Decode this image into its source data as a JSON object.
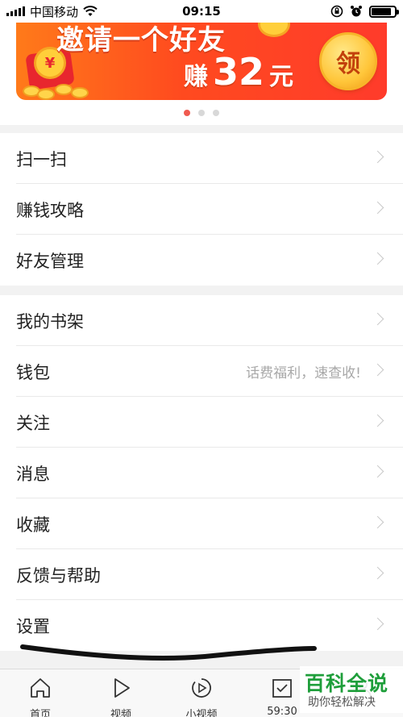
{
  "status_bar": {
    "carrier": "中国移动",
    "time": "09:15",
    "battery_level": 0.85
  },
  "banner": {
    "title": "邀请一个好友",
    "earn_prefix": "赚",
    "earn_amount": "32",
    "earn_unit": "元",
    "claim_label": "领",
    "coin_symbol": "¥",
    "page_count": 3,
    "active_page": 0
  },
  "menu": {
    "group1": [
      {
        "label": "扫一扫"
      },
      {
        "label": "赚钱攻略"
      },
      {
        "label": "好友管理"
      }
    ],
    "group2": [
      {
        "label": "我的书架"
      },
      {
        "label": "钱包",
        "hint": "话费福利，速查收!"
      },
      {
        "label": "关注"
      },
      {
        "label": "消息"
      },
      {
        "label": "收藏"
      },
      {
        "label": "反馈与帮助"
      },
      {
        "label": "设置"
      }
    ]
  },
  "tabbar": {
    "tabs": [
      {
        "label": "首页",
        "icon": "home-icon"
      },
      {
        "label": "视频",
        "icon": "play-icon"
      },
      {
        "label": "小视频",
        "icon": "mini-video-icon"
      },
      {
        "label": "59:30",
        "icon": "task-check-icon"
      },
      {
        "label": "",
        "icon": "profile-icon"
      }
    ]
  },
  "watermark": {
    "main": "百科全说",
    "sub": "助你轻松解决"
  },
  "colors": {
    "banner_start": "#ff7a1a",
    "banner_end": "#ff3b2b",
    "dot_active": "#f05a4f",
    "watermark_green": "#1e9e3a"
  }
}
